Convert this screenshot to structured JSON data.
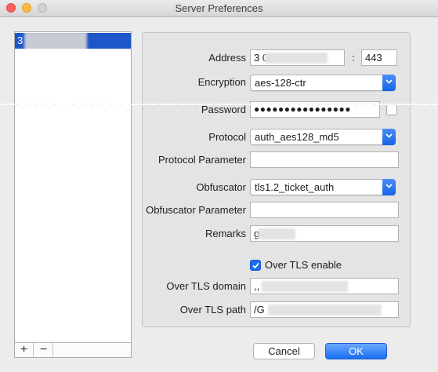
{
  "window": {
    "title": "Server Preferences"
  },
  "server_list": {
    "items": [
      {
        "label": "3 0"
      }
    ],
    "toolbar": {
      "add": "+",
      "remove": "−"
    }
  },
  "form": {
    "address": {
      "label": "Address",
      "host": "3 0",
      "separator": ":",
      "port": "443"
    },
    "encryption": {
      "label": "Encryption",
      "value": "aes-128-ctr"
    },
    "password": {
      "label": "Password",
      "value": "●●●●●●●●●●●●●●●●",
      "show_checked": false
    },
    "protocol": {
      "label": "Protocol",
      "value": "auth_aes128_md5"
    },
    "protocol_param": {
      "label": "Protocol Parameter",
      "value": ""
    },
    "obfuscator": {
      "label": "Obfuscator",
      "value": "tls1.2_ticket_auth"
    },
    "obfuscator_param": {
      "label": "Obfuscator Parameter",
      "value": ""
    },
    "remarks": {
      "label": "Remarks",
      "value": "g ot"
    },
    "over_tls_enable": {
      "label": "Over TLS enable",
      "checked": true
    },
    "over_tls_domain": {
      "label": "Over TLS domain",
      "value": ",,"
    },
    "over_tls_path": {
      "label": "Over TLS path",
      "value": "/G"
    }
  },
  "buttons": {
    "cancel": "Cancel",
    "ok": "OK"
  },
  "colors": {
    "accent": "#1c56c9",
    "ok_button": "#1b6ef3"
  }
}
